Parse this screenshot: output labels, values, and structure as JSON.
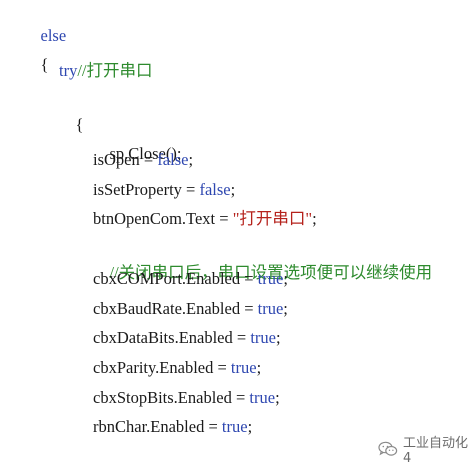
{
  "code": {
    "else_kw": "else",
    "open_brace_outer": "{",
    "try_kw": "try",
    "try_comment": "//打开串口",
    "open_brace_inner": "{",
    "l_close_obj": "sp.Close();",
    "l_isopen_lhs": "isOpen = ",
    "l_isopen_val": "false",
    "l_isopen_semi": ";",
    "l_isset_lhs": "isSetProperty = ",
    "l_isset_val": "false",
    "l_isset_semi": ";",
    "l_btn_lhs": "btnOpenCom.Text = ",
    "l_btn_str": "\"打开串口\"",
    "l_btn_semi": ";",
    "l_comment": "//关闭串口后，串口设置选项便可以继续使用",
    "l_port_lhs": "cbxCOMPort.Enabled = ",
    "l_port_val": "true",
    "l_port_semi": ";",
    "l_baud_lhs": "cbxBaudRate.Enabled = ",
    "l_baud_val": "true",
    "l_baud_semi": ";",
    "l_data_lhs": "cbxDataBits.Enabled = ",
    "l_data_val": "true",
    "l_data_semi": ";",
    "l_parity_lhs": "cbxParity.Enabled = ",
    "l_parity_val": "true",
    "l_parity_semi": ";",
    "l_stop_lhs": "cbxStopBits.Enabled = ",
    "l_stop_val": "true",
    "l_stop_semi": ";",
    "l_char_lhs": "rbnChar.Enabled = ",
    "l_char_val": "true",
    "l_char_semi": ";"
  },
  "watermark": {
    "text": "工业自动化4",
    "icon": "wechat-icon"
  },
  "colors": {
    "keyword": "#2e47b0",
    "comment": "#2e8b2e",
    "string": "#b5221c",
    "text": "#1a1a1a"
  }
}
